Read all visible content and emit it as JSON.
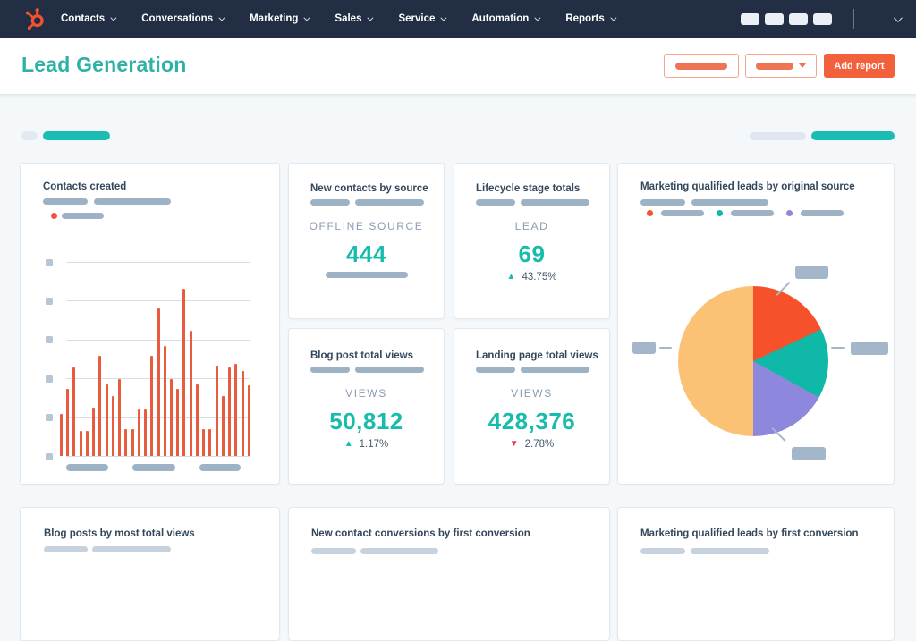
{
  "colors": {
    "navbar_bg": "#212e43",
    "accent_teal": "#17bcab",
    "title_teal": "#2fb1a5",
    "accent_orange": "#f2613b",
    "bar_orange": "#e75b3e",
    "delta_red": "#ee3e4e",
    "placeholder_gray": "#9eb2c6",
    "pie_colors": [
      "#f6512b",
      "#10b9a7",
      "#8d87dd",
      "#fbc276"
    ]
  },
  "navbar": {
    "menus": [
      "Contacts",
      "Conversations",
      "Marketing",
      "Sales",
      "Service",
      "Automation",
      "Reports"
    ],
    "icon_placeholder_count": 4
  },
  "header": {
    "title": "Lead Generation",
    "add_report_label": "Add report"
  },
  "cards": {
    "contacts_created": {
      "title": "Contacts created"
    },
    "new_contacts_by_source": {
      "title": "New contacts by source",
      "metric_label": "OFFLINE SOURCE",
      "value": "444"
    },
    "lifecycle_stage_totals": {
      "title": "Lifecycle stage totals",
      "metric_label": "LEAD",
      "value": "69",
      "delta": "43.75%",
      "delta_direction": "up"
    },
    "blog_post_total_views": {
      "title": "Blog post total views",
      "metric_label": "VIEWS",
      "value": "50,812",
      "delta": "1.17%",
      "delta_direction": "up"
    },
    "landing_page_total_views": {
      "title": "Landing page total views",
      "metric_label": "VIEWS",
      "value": "428,376",
      "delta": "2.78%",
      "delta_direction": "down"
    },
    "mql_by_original_source": {
      "title": "Marketing qualified leads by original source",
      "legend_colors": [
        "#f6512b",
        "#10b9a7",
        "#8d87dd"
      ]
    },
    "blog_posts_by_most_total_views": {
      "title": "Blog posts by most total views"
    },
    "new_contact_conversions_by_first_conversion": {
      "title": "New contact conversions by first conversion"
    },
    "mql_by_first_conversion": {
      "title": "Marketing qualified leads by first conversion"
    }
  },
  "chart_data": [
    {
      "type": "bar",
      "title": "Contacts created",
      "values": [
        25,
        40,
        53,
        15,
        15,
        29,
        60,
        43,
        36,
        46,
        16,
        16,
        28,
        28,
        60,
        88,
        66,
        46,
        40,
        100,
        75,
        43,
        16,
        16,
        54,
        36,
        53,
        55,
        51,
        42
      ],
      "ylim": [
        0,
        100
      ],
      "color": "#e75b3e",
      "grid": true,
      "x_tick_labels": "placeholder-bars",
      "y_tick_labels": "placeholder-squares",
      "legend": "single orange series (placeholder label)"
    },
    {
      "type": "pie",
      "title": "Marketing qualified leads by original source",
      "slices": [
        {
          "label": "slice-1",
          "pct": 18,
          "color": "#f6512b"
        },
        {
          "label": "slice-2",
          "pct": 15,
          "color": "#10b9a7"
        },
        {
          "label": "slice-3",
          "pct": 17,
          "color": "#8d87dd"
        },
        {
          "label": "slice-4",
          "pct": 50,
          "color": "#fbc276"
        }
      ],
      "start_angle_deg": 0,
      "legend_position": "top",
      "callout_labels": "placeholder-bars"
    }
  ]
}
